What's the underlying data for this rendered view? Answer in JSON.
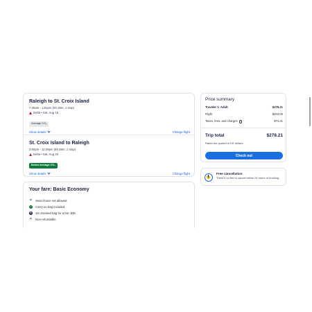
{
  "flights": [
    {
      "route": "Raleigh to St. Croix Island",
      "times": "7:25am - 1:51pm (5h 26m, 1 stop)",
      "airline_date": "Delta • Sat, Aug 16",
      "badge": "Average CO₂",
      "show_details": "Show details",
      "change_flight": "Change flight"
    },
    {
      "route": "St. Croix Island to Raleigh",
      "times": "3:00pm - 11:39pm (8h 59m, 1 stop)",
      "airline_date": "Delta • Sat, Aug 23",
      "badge": "Below average CO₂",
      "show_details": "Show details",
      "change_flight": "Change flight"
    }
  ],
  "fare": {
    "title": "Your fare: Basic Economy",
    "items": [
      {
        "icon": "x-icon",
        "text": "Seat choice not allowed"
      },
      {
        "icon": "check-circle-icon",
        "text": "Carry-on bag included"
      },
      {
        "icon": "dollar-circle-icon",
        "text": "1st checked bag for a fee: $35"
      },
      {
        "icon": "x-icon",
        "text": "Non-refundable"
      }
    ]
  },
  "price_summary": {
    "title": "Price summary",
    "traveler_label": "Traveler 1: Adult",
    "traveler_value": "$278.21",
    "flight_label": "Flight",
    "flight_value": "$204.00",
    "taxes_label": "Taxes, fees, and charges",
    "taxes_value": "$74.21",
    "total_label": "Trip total",
    "total_value": "$278.21",
    "rates_note": "Rates are quoted in US dollars",
    "checkout_label": "Check out"
  },
  "cancellation": {
    "title": "Free cancellation",
    "text": "There's no fee to cancel within 24 hours of booking."
  },
  "colors": {
    "accent": "#1a6fe0",
    "below_average_badge": "#0f7a3d",
    "delta_red": "#c8102e"
  }
}
